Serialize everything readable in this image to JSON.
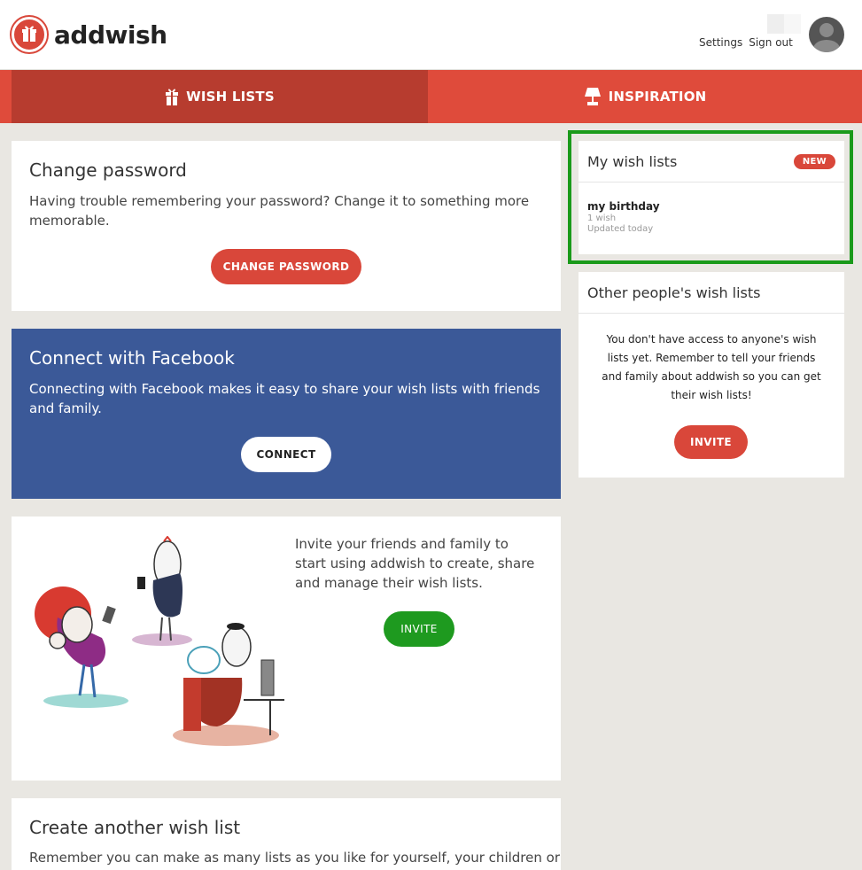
{
  "header": {
    "brand": "addwish",
    "settings": "Settings",
    "signout": "Sign out"
  },
  "nav": {
    "wishlists": "WISH LISTS",
    "inspiration": "INSPIRATION"
  },
  "change_password": {
    "title": "Change password",
    "text": "Having trouble remembering your password? Change it to something more memorable.",
    "button": "CHANGE PASSWORD"
  },
  "facebook": {
    "title": "Connect with Facebook",
    "text": "Connecting with Facebook makes it easy to share your wish lists with friends and family.",
    "button": "CONNECT"
  },
  "invite_card": {
    "text": "Invite your friends and family to start using addwish to create, share and manage their wish lists.",
    "button": "INVITE"
  },
  "create_list": {
    "title": "Create another wish list",
    "text": "Remember you can make as many lists as you like for yourself, your children or"
  },
  "my_wishlists": {
    "title": "My wish lists",
    "badge": "NEW",
    "item_name": "my birthday",
    "item_count": "1 wish",
    "item_updated": "Updated today"
  },
  "other_lists": {
    "title": "Other people's wish lists",
    "text": "You don't have access to anyone's wish lists yet. Remember to tell your friends and family about addwish so you can get their wish lists!",
    "button": "INVITE"
  },
  "colors": {
    "brand_red": "#d9473a",
    "nav_active": "#b73c2f",
    "facebook_blue": "#3b5998",
    "invite_green": "#1e9a1f",
    "highlight_green": "#1a9a1a"
  }
}
